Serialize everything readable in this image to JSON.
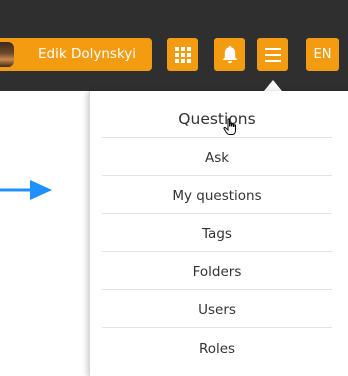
{
  "user": {
    "name": "Edik Dolynskyi"
  },
  "header_buttons": {
    "apps_icon": "grid-icon",
    "notifications_icon": "bell-icon",
    "menu_icon": "hamburger-icon",
    "language": "EN"
  },
  "menu": {
    "header": "Questions",
    "items": [
      {
        "label": "Ask"
      },
      {
        "label": "My questions"
      },
      {
        "label": "Tags"
      },
      {
        "label": "Folders"
      },
      {
        "label": "Users"
      },
      {
        "label": "Roles"
      }
    ]
  },
  "colors": {
    "topbar": "#2f2f2f",
    "accent": "#f39c12",
    "pointer_arrow": "#1e90ff"
  }
}
